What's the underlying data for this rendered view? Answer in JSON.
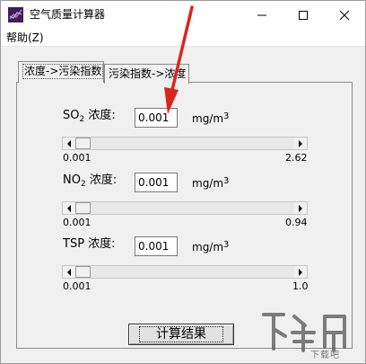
{
  "window": {
    "title": "空气质量计算器",
    "controls": {
      "minimize": "—",
      "maximize": "☐",
      "close": "✕"
    }
  },
  "menu": {
    "help": "帮助(Z)"
  },
  "tabs": [
    {
      "label": "浓度->污染指数",
      "active": true
    },
    {
      "label": "污染指数->浓度",
      "active": false
    }
  ],
  "inputs": [
    {
      "label_main": "SO",
      "label_sub": "2",
      "label_suffix": " 浓度:",
      "value": "0.001",
      "unit_main": "mg/m",
      "unit_sup": "3",
      "scroll_min": "0.001",
      "scroll_max": "2.62",
      "scroll_level": 0
    },
    {
      "label_main": "NO",
      "label_sub": "2",
      "label_suffix": " 浓度:",
      "value": "0.001",
      "unit_main": "mg/m",
      "unit_sup": "3",
      "scroll_min": "0.001",
      "scroll_max": "0.94",
      "scroll_level": 0
    },
    {
      "label_main": "TSP",
      "label_sub": "",
      "label_suffix": " 浓度:",
      "value": "0.001",
      "unit_main": "mg/m",
      "unit_sup": "3",
      "scroll_min": "0.001",
      "scroll_max": "1.0",
      "scroll_level": 0
    }
  ],
  "button": {
    "calculate": "计算结果"
  },
  "watermark": {
    "text": "下载吧",
    "color": "#555555"
  },
  "annotation": {
    "arrow_color": "#d9261c"
  }
}
